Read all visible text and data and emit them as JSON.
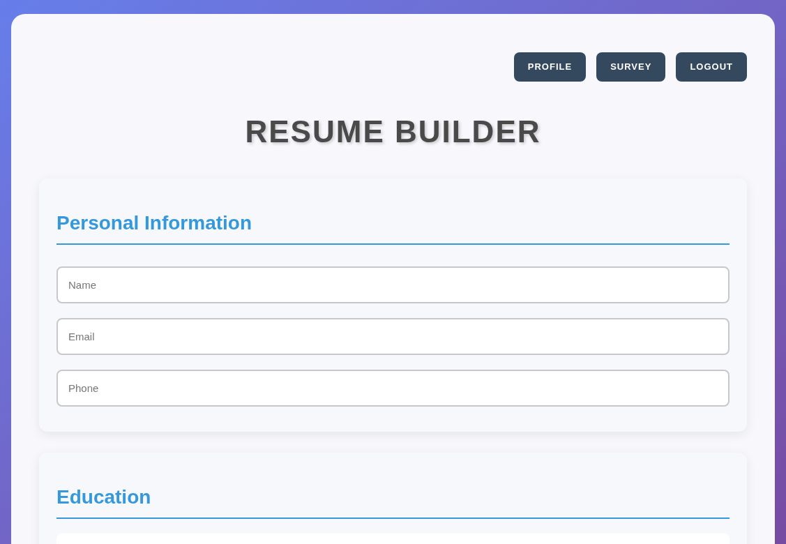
{
  "nav_buttons": [
    "PROFILE",
    "SURVEY",
    "LOGOUT"
  ],
  "title": "RESUME BUILDER",
  "sections": [
    {
      "heading": "Personal Information",
      "fields": [
        {
          "placeholder": "Name"
        },
        {
          "placeholder": "Email"
        },
        {
          "placeholder": "Phone"
        }
      ]
    },
    {
      "heading": "Education"
    }
  ]
}
